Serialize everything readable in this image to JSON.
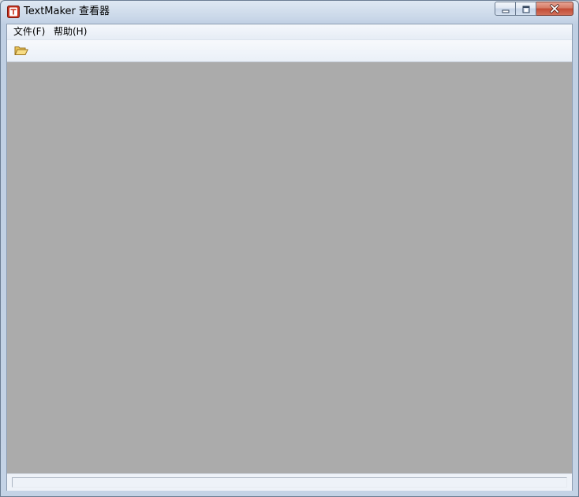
{
  "window": {
    "title": "TextMaker 查看器",
    "app_icon": "textmaker-app-icon"
  },
  "caption_buttons": {
    "minimize_icon": "minimize-icon",
    "maximize_icon": "maximize-icon",
    "close_icon": "close-icon"
  },
  "menubar": {
    "items": [
      {
        "label": "文件(F)",
        "mnemonic": "F"
      },
      {
        "label": "帮助(H)",
        "mnemonic": "H"
      }
    ]
  },
  "toolbar": {
    "open_icon": "open-folder-icon"
  },
  "content": {
    "background": "#ababab"
  },
  "statusbar": {
    "text": ""
  },
  "colors": {
    "close_button": "#c24b34",
    "content_area": "#ababab",
    "window_frame": "#c4d3e6"
  }
}
